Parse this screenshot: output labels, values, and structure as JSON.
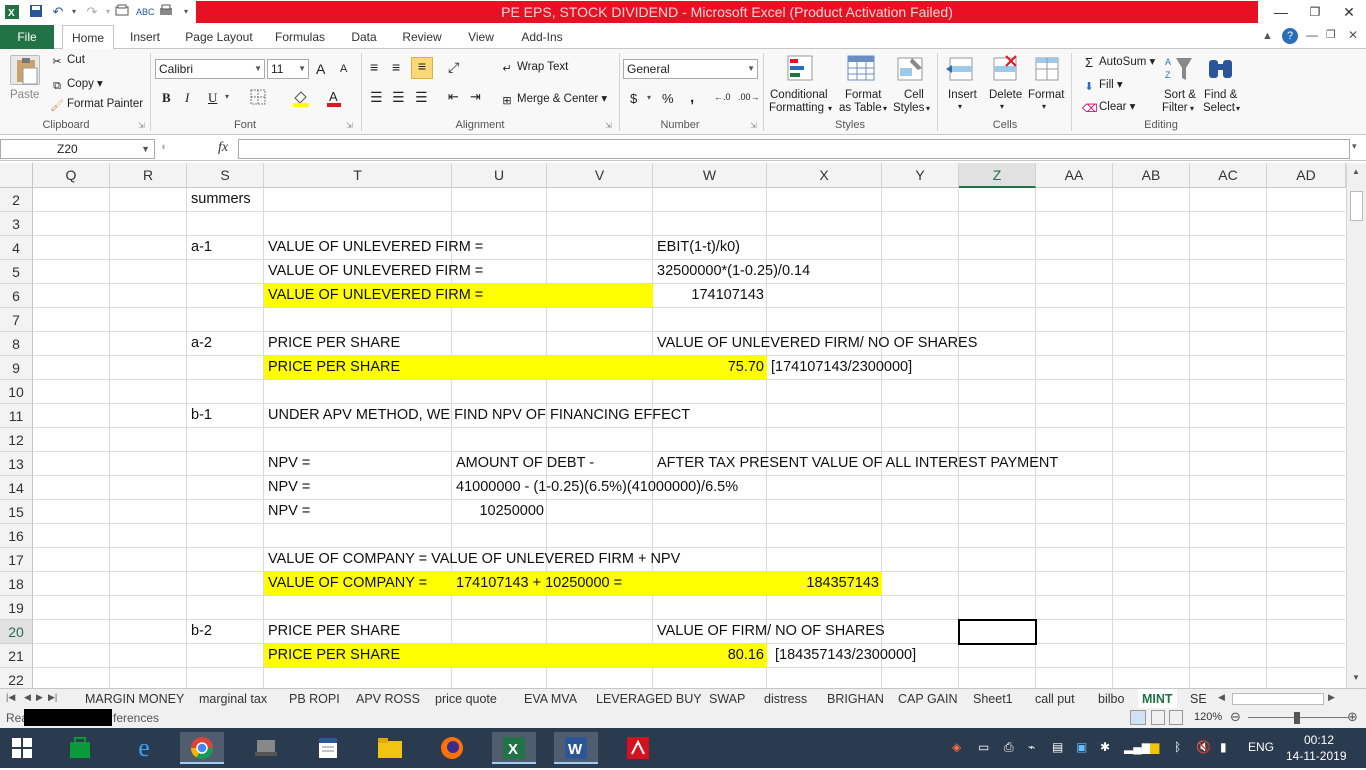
{
  "window": {
    "title": "PE EPS, STOCK DIVIDEND  -  Microsoft Excel (Product Activation Failed)",
    "minimize": "—",
    "restore": "❐",
    "close": "✕"
  },
  "menu": {
    "tabs": [
      "File",
      "Home",
      "Insert",
      "Page Layout",
      "Formulas",
      "Data",
      "Review",
      "View",
      "Add-Ins"
    ]
  },
  "ribbon": {
    "clipboard": {
      "paste": "Paste",
      "cut": "Cut",
      "copy": "Copy",
      "format_painter": "Format Painter",
      "label": "Clipboard"
    },
    "font": {
      "name": "Calibri",
      "size": "11",
      "bold": "B",
      "italic": "I",
      "underline": "U",
      "grow": "A",
      "shrink": "A",
      "label": "Font"
    },
    "alignment": {
      "wrap_text": "Wrap Text",
      "merge_center": "Merge & Center",
      "label": "Alignment"
    },
    "number": {
      "format": "General",
      "currency": "$",
      "percent": "%",
      "comma": ",",
      "label": "Number"
    },
    "styles": {
      "conditional": "Conditional",
      "conditional2": "Formatting",
      "format_table": "Format",
      "format_table2": "as Table",
      "cell_styles": "Cell",
      "cell_styles2": "Styles",
      "label": "Styles"
    },
    "cells": {
      "insert": "Insert",
      "delete": "Delete",
      "format": "Format",
      "label": "Cells"
    },
    "editing": {
      "autosum": "AutoSum",
      "fill": "Fill",
      "clear": "Clear",
      "sort": "Sort &",
      "sort2": "Filter",
      "find": "Find &",
      "find2": "Select",
      "label": "Editing"
    }
  },
  "formula_bar": {
    "name_box": "Z20",
    "fx": "fx",
    "value": ""
  },
  "columns": [
    "Q",
    "R",
    "S",
    "T",
    "U",
    "V",
    "W",
    "X",
    "Y",
    "Z",
    "AA",
    "AB",
    "AC",
    "AD"
  ],
  "rows": [
    "2",
    "3",
    "4",
    "5",
    "6",
    "7",
    "8",
    "9",
    "10",
    "11",
    "12",
    "13",
    "14",
    "15",
    "16",
    "17",
    "18",
    "19",
    "20",
    "21",
    "22"
  ],
  "cells": {
    "s2": "summers",
    "s4": "a-1",
    "t4": "VALUE OF UNLEVERED FIRM =",
    "w4": "EBIT(1-t)/k0)",
    "t5": "VALUE OF UNLEVERED FIRM =",
    "w5": "32500000*(1-0.25)/0.14",
    "t6": "VALUE OF UNLEVERED FIRM =",
    "w6": "174107143",
    "s8": "a-2",
    "t8": "PRICE PER SHARE",
    "w8": "VALUE OF UNLEVERED FIRM/ NO OF SHARES",
    "t9": "PRICE PER SHARE",
    "w9": "75.70",
    "x9": "[174107143/2300000]",
    "s11": "b-1",
    "t11": "UNDER APV METHOD, WE FIND NPV OF FINANCING EFFECT",
    "t13": "NPV =",
    "u13": "AMOUNT OF DEBT -",
    "w13": "AFTER TAX PRESENT VALUE OF ALL INTEREST PAYMENT",
    "t14": "NPV =",
    "u14": "41000000 - (1-0.25)(6.5%)(41000000)/6.5%",
    "t15": "NPV =",
    "u15": "10250000",
    "t17": "VALUE OF COMPANY = VALUE OF UNLEVERED FIRM + NPV",
    "t18": "VALUE OF COMPANY =",
    "u18": "174107143 + 10250000 =",
    "x18": "184357143",
    "s20": "b-2",
    "t20": "PRICE PER SHARE",
    "w20": "VALUE OF  FIRM/ NO OF SHARES",
    "t21": "PRICE PER SHARE",
    "w21": "80.16",
    "x21": "[184357143/2300000]"
  },
  "sheets": [
    "MARGIN MONEY",
    "marginal tax",
    "PB ROPI",
    "APV ROSS",
    "price quote",
    "EVA MVA",
    "LEVERAGED BUY",
    "SWAP",
    "distress",
    "BRIGHAN",
    "CAP GAIN",
    "Sheet1",
    "call put",
    "bilbo",
    "MINT",
    "SE"
  ],
  "active_sheet": "MINT",
  "status": {
    "left": "Rea",
    "left2": "ferences",
    "zoom": "120%"
  },
  "taskbar": {
    "lang": "ENG",
    "time": "00:12",
    "date": "14-11-2019"
  },
  "colors": {
    "excel_green": "#217346",
    "highlight": "#ffff00",
    "title_red": "#e81123"
  }
}
